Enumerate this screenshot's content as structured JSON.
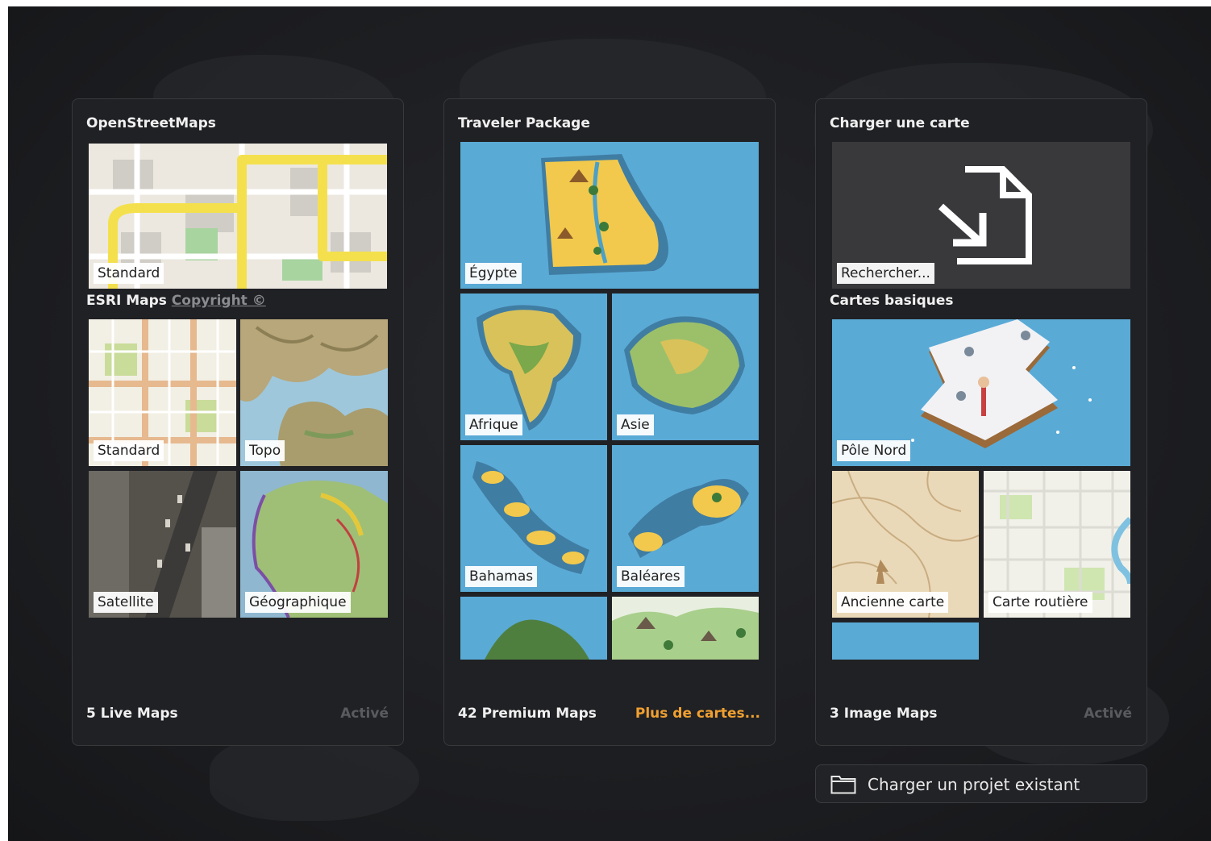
{
  "panels": {
    "osm": {
      "title": "OpenStreetMaps",
      "tiles": [
        {
          "label": "Standard"
        }
      ],
      "esri_title": "ESRI Maps",
      "esri_link": "Copyright ©",
      "esri_tiles": [
        {
          "label": "Standard"
        },
        {
          "label": "Topo"
        },
        {
          "label": "Satellite"
        },
        {
          "label": "Géographique"
        }
      ],
      "footer": "5 Live Maps",
      "status": "Activé"
    },
    "traveler": {
      "title": "Traveler Package",
      "tiles": [
        {
          "label": "Égypte"
        },
        {
          "label": "Afrique"
        },
        {
          "label": "Asie"
        },
        {
          "label": "Bahamas"
        },
        {
          "label": "Baléares"
        }
      ],
      "footer": "42 Premium Maps",
      "status": "Plus de cartes..."
    },
    "load": {
      "title": "Charger une carte",
      "browse_label": "Rechercher...",
      "basic_title": "Cartes basiques",
      "tiles": [
        {
          "label": "Pôle Nord"
        },
        {
          "label": "Ancienne carte"
        },
        {
          "label": "Carte routière"
        }
      ],
      "footer": "3 Image Maps",
      "status": "Activé"
    }
  },
  "load_project": {
    "label": "Charger un projet existant",
    "icon": "folder-icon"
  },
  "colors": {
    "background": "#1b1c1f",
    "panel": "#202124",
    "accent_link": "#f0a030",
    "status_inactive": "#5a5b5f",
    "water": "#5aaad6"
  }
}
